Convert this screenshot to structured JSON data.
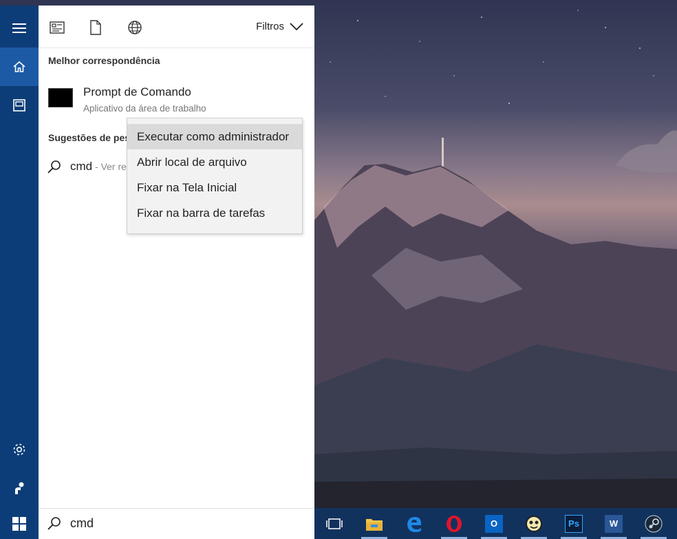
{
  "toolbar": {
    "filters_label": "Filtros",
    "icons": [
      "document-list-icon",
      "file-icon",
      "globe-icon",
      "chevron-down-icon"
    ]
  },
  "best_match": {
    "section_title": "Melhor correspondência",
    "title": "Prompt de Comando",
    "subtitle": "Aplicativo da área de trabalho"
  },
  "suggestions": {
    "section_title": "Sugestões de pes",
    "item_text": "cmd",
    "item_hint": " - Ver re"
  },
  "context_menu": {
    "items": [
      {
        "label": "Executar como administrador",
        "hovered": true
      },
      {
        "label": "Abrir local de arquivo",
        "hovered": false
      },
      {
        "label": "Fixar na Tela Inicial",
        "hovered": false
      },
      {
        "label": "Fixar na barra de tarefas",
        "hovered": false
      }
    ]
  },
  "search": {
    "value": "cmd"
  },
  "rail": {
    "items": [
      "hamburger-icon",
      "home-icon",
      "notebook-icon",
      "settings-icon",
      "feedback-icon"
    ]
  },
  "taskbar": {
    "apps": [
      "task-view-icon",
      "file-explorer-icon",
      "edge-icon",
      "opera-icon",
      "outlook-icon",
      "app-icon",
      "photoshop-icon",
      "word-icon",
      "steam-icon"
    ],
    "tile_labels": {
      "outlook": "O",
      "photoshop": "Ps",
      "word": "W"
    }
  },
  "colors": {
    "rail": "#0d3d78",
    "rail_active": "#1c5aa6",
    "taskbar": "#12325e",
    "menu_hover": "#dadada"
  }
}
